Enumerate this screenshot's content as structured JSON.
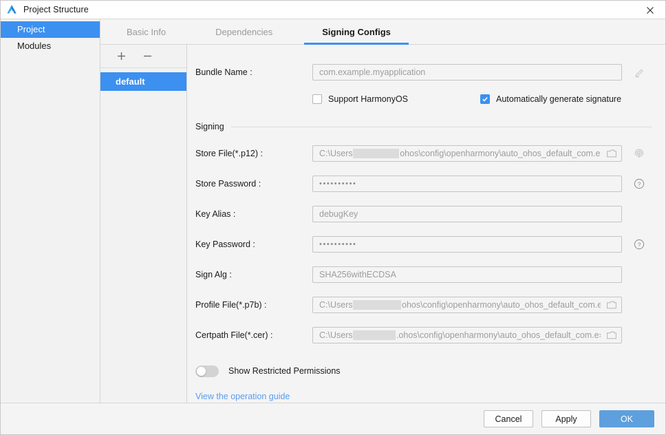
{
  "window": {
    "title": "Project Structure",
    "app_icon": "deveco-logo-icon",
    "close_icon": "close-icon"
  },
  "sidebar": {
    "items": [
      {
        "label": "Project",
        "selected": true
      },
      {
        "label": "Modules",
        "selected": false
      }
    ]
  },
  "tabs": [
    {
      "label": "Basic Info",
      "active": false
    },
    {
      "label": "Dependencies",
      "active": false
    },
    {
      "label": "Signing Configs",
      "active": true
    }
  ],
  "configs_panel": {
    "add_label": "+",
    "remove_label": "−",
    "items": [
      {
        "label": "default",
        "selected": true
      }
    ]
  },
  "form": {
    "bundle_name": {
      "label": "Bundle Name :",
      "value": "com.example.myapplication",
      "placeholder": "com.example.myapplication",
      "edit_icon": "pencil-icon"
    },
    "checkboxes": [
      {
        "label": "Support HarmonyOS",
        "checked": false
      },
      {
        "label": "Automatically generate signature",
        "checked": true
      }
    ],
    "signing_group_title": "Signing",
    "rows": [
      {
        "label": "Store File(*.p12) :",
        "type": "path",
        "prefix": "C:\\Users",
        "suffix": "ohos\\config\\openharmony\\auto_ohos_default_com.e›",
        "redact_width": 68,
        "folder_icon": "folder-icon",
        "side_icon": "fingerprint-icon"
      },
      {
        "label": "Store Password :",
        "type": "password",
        "value": "••••••••••",
        "side_icon": "help-icon"
      },
      {
        "label": "Key Alias :",
        "type": "text",
        "value": "debugKey"
      },
      {
        "label": "Key Password :",
        "type": "password",
        "value": "••••••••••",
        "side_icon": "help-icon"
      },
      {
        "label": "Sign Alg :",
        "type": "text",
        "value": "SHA256withECDSA"
      },
      {
        "label": "Profile File(*.p7b) :",
        "type": "path",
        "prefix": "C:\\Users",
        "suffix": "ohos\\config\\openharmony\\auto_ohos_default_com.e›",
        "redact_width": 72,
        "folder_icon": "folder-icon"
      },
      {
        "label": "Certpath File(*.cer) :",
        "type": "path",
        "prefix": "C:\\Users",
        "suffix": ".ohos\\config\\openharmony\\auto_ohos_default_com.e›",
        "redact_width": 62,
        "folder_icon": "folder-icon"
      }
    ],
    "restricted_toggle": {
      "label": "Show Restricted Permissions",
      "on": false
    },
    "guide_link": "View the operation guide"
  },
  "footer": {
    "cancel": "Cancel",
    "apply": "Apply",
    "ok": "OK"
  },
  "colors": {
    "accent_blue": "#3c90f0",
    "primary_button": "#5e9fdd",
    "link_blue": "#5a9cf0",
    "window_bg": "#f4f4f4"
  }
}
